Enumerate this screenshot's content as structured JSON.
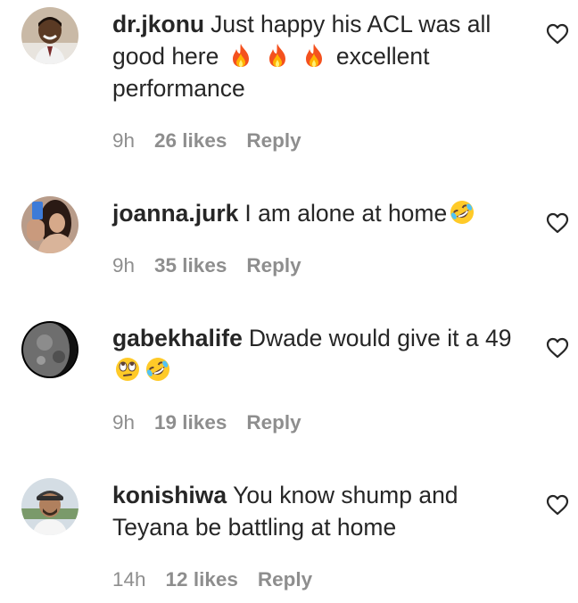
{
  "comments": [
    {
      "username": "dr.jkonu",
      "text_before": "Just happy his ACL was all good here",
      "text_after": "excellent performance",
      "emojis": [
        "fire-emoji",
        "fire-emoji",
        "fire-emoji"
      ],
      "time": "9h",
      "likes": "26 likes",
      "reply": "Reply",
      "avatar": "avatar-man-smiling"
    },
    {
      "username": "joanna.jurk",
      "text_before": "I am alone at home",
      "text_after": "",
      "emojis": [
        "rofl-emoji"
      ],
      "time": "9h",
      "likes": "35 likes",
      "reply": "Reply",
      "avatar": "avatar-woman-selfie"
    },
    {
      "username": "gabekhalife",
      "text_before": "Dwade would give it a 49",
      "text_after": "",
      "emojis": [
        "eye-roll-emoji",
        "rofl-emoji"
      ],
      "time": "9h",
      "likes": "19 likes",
      "reply": "Reply",
      "avatar": "avatar-moon"
    },
    {
      "username": "konishiwa",
      "text_before": "You know shump and Teyana be battling at home",
      "text_after": "",
      "emojis": [],
      "time": "14h",
      "likes": "12 likes",
      "reply": "Reply",
      "avatar": "avatar-man-cap"
    }
  ],
  "colors": {
    "text": "#262626",
    "meta": "#8e8e8e"
  }
}
